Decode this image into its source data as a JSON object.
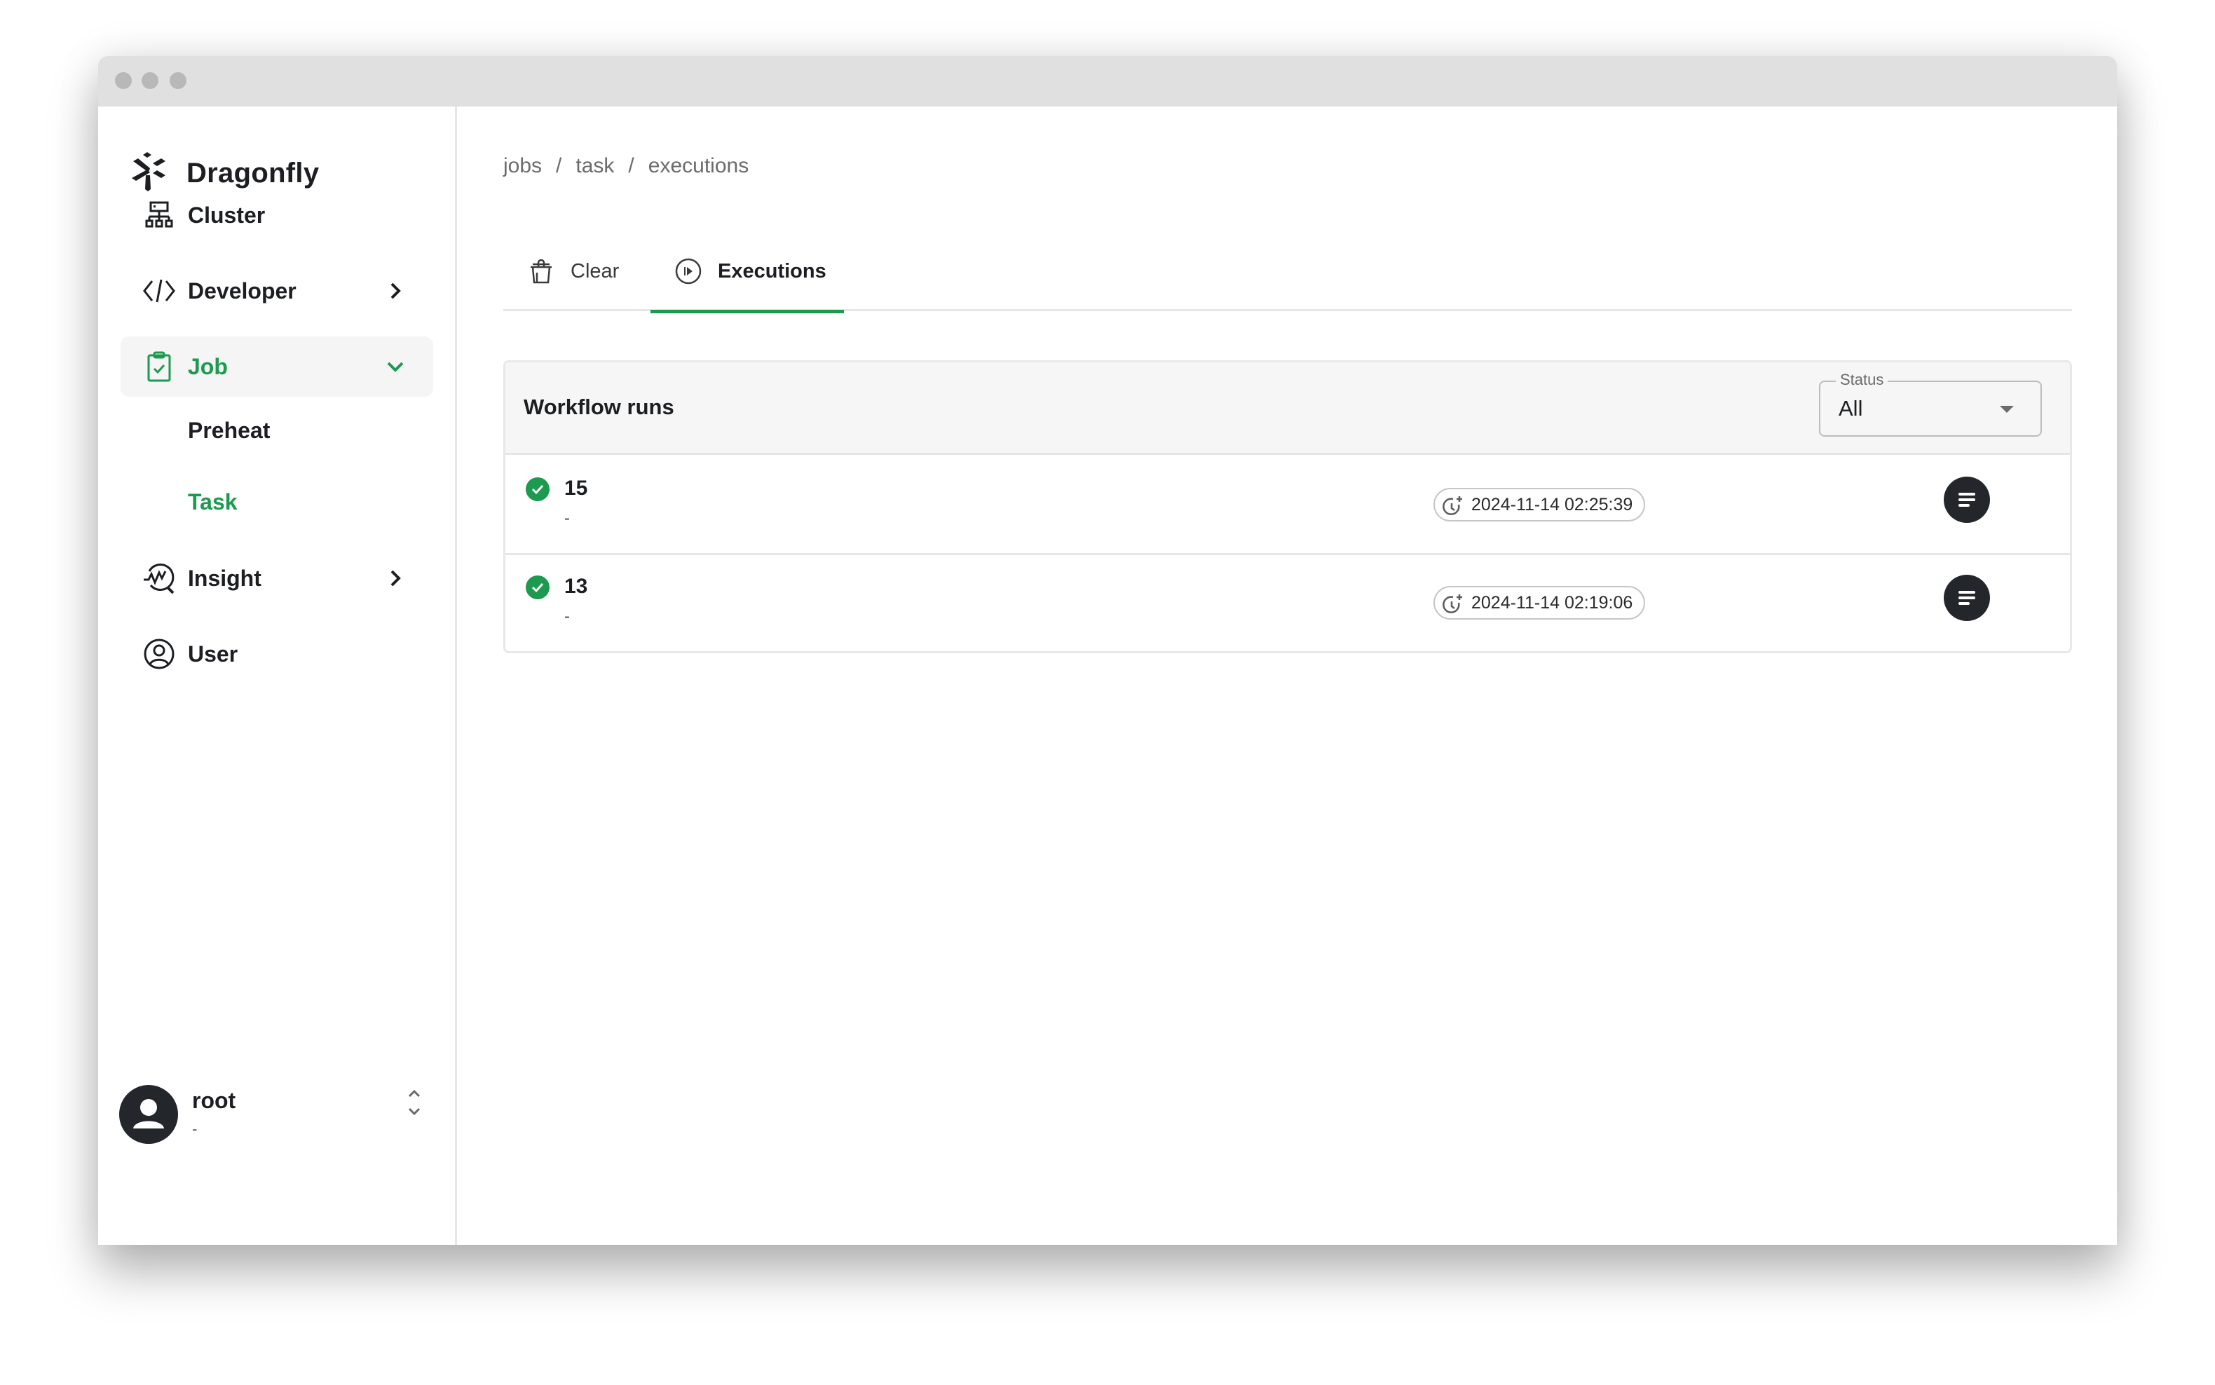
{
  "window": {
    "controls": [
      "close",
      "minimize",
      "maximize"
    ]
  },
  "brand": {
    "name": "Dragonfly",
    "icon": "dragonfly-logo-icon"
  },
  "sidebar": {
    "items": [
      {
        "label": "Cluster",
        "icon": "cluster-icon",
        "expandable": false
      },
      {
        "label": "Developer",
        "icon": "code-icon",
        "expandable": true,
        "expanded": false
      },
      {
        "label": "Job",
        "icon": "clipboard-check-icon",
        "expandable": true,
        "expanded": true,
        "active": true,
        "children": [
          {
            "label": "Preheat"
          },
          {
            "label": "Task",
            "active": true
          }
        ]
      },
      {
        "label": "Insight",
        "icon": "insight-icon",
        "expandable": true,
        "expanded": false
      },
      {
        "label": "User",
        "icon": "user-circle-icon",
        "expandable": false
      }
    ],
    "user": {
      "name": "root",
      "subtitle": "-",
      "icon": "avatar-icon"
    }
  },
  "breadcrumb": {
    "items": [
      "jobs",
      "task",
      "executions"
    ],
    "separator": "/"
  },
  "tabs": [
    {
      "label": "Clear",
      "icon": "trash-icon",
      "active": false
    },
    {
      "label": "Executions",
      "icon": "play-circle-icon",
      "active": true
    }
  ],
  "workflow_runs": {
    "title": "Workflow runs",
    "status_filter": {
      "label": "Status",
      "value": "All"
    },
    "rows": [
      {
        "id": "15",
        "subtitle": "-",
        "status": "success",
        "created_at": "2024-11-14 02:25:39"
      },
      {
        "id": "13",
        "subtitle": "-",
        "status": "success",
        "created_at": "2024-11-14 02:19:06"
      }
    ]
  },
  "colors": {
    "accent": "#1c9a4f",
    "text": "#1c1e21",
    "muted": "#6b6b6b",
    "border": "#e6e6e6",
    "header_bg": "#f6f6f6",
    "dark_button": "#23272b"
  }
}
